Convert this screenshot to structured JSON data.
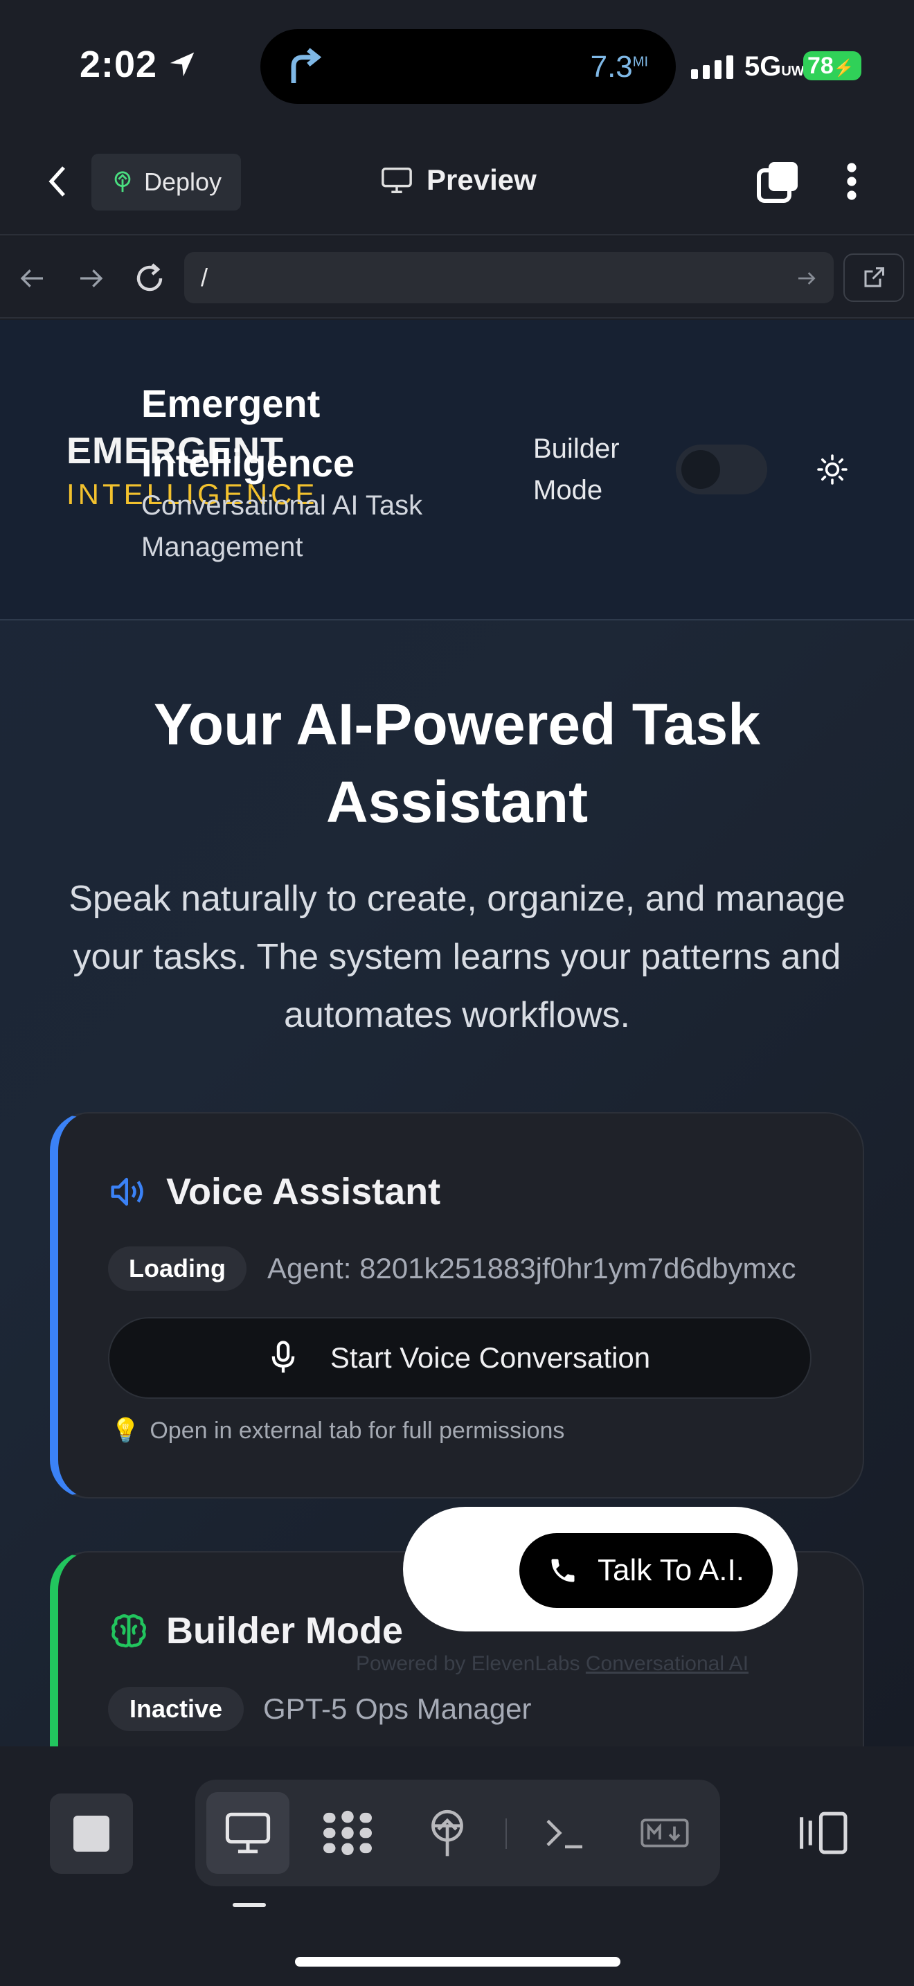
{
  "status_bar": {
    "time": "2:02",
    "distance": "7.3",
    "distance_unit": "MI",
    "network": "5G",
    "network_sub": "UW",
    "battery": "78"
  },
  "toolbar": {
    "deploy_label": "Deploy",
    "preview_label": "Preview"
  },
  "url_bar": {
    "value": "/"
  },
  "app_header": {
    "logo_line1": "EMERGENT",
    "logo_line2": "INTELLIGENCE",
    "brand_title": "Emergent Intelligence",
    "brand_subtitle": "Conversational AI Task Management",
    "builder_mode_label": "Builder Mode",
    "builder_mode_on": false
  },
  "hero": {
    "title": "Your AI-Powered Task Assistant",
    "subtitle": "Speak naturally to create, organize, and manage your tasks. The system learns your patterns and automates workflows."
  },
  "voice_card": {
    "title": "Voice Assistant",
    "status": "Loading",
    "agent": "Agent: 8201k251883jf0hr1ym7d6dbymxc",
    "start_button": "Start Voice Conversation",
    "tip": "Open in external tab for full permissions",
    "accent": "#3b82f6"
  },
  "builder_card": {
    "title": "Builder Mode",
    "status": "Inactive",
    "model": "GPT-5 Ops Manager",
    "accent": "#22c55e"
  },
  "widget": {
    "talk_button": "Talk To A.I.",
    "powered_prefix": "Powered by ElevenLabs",
    "powered_link": "Conversational AI"
  },
  "colors": {
    "logo_accent": "#f2c12e",
    "battery": "#30d158"
  }
}
